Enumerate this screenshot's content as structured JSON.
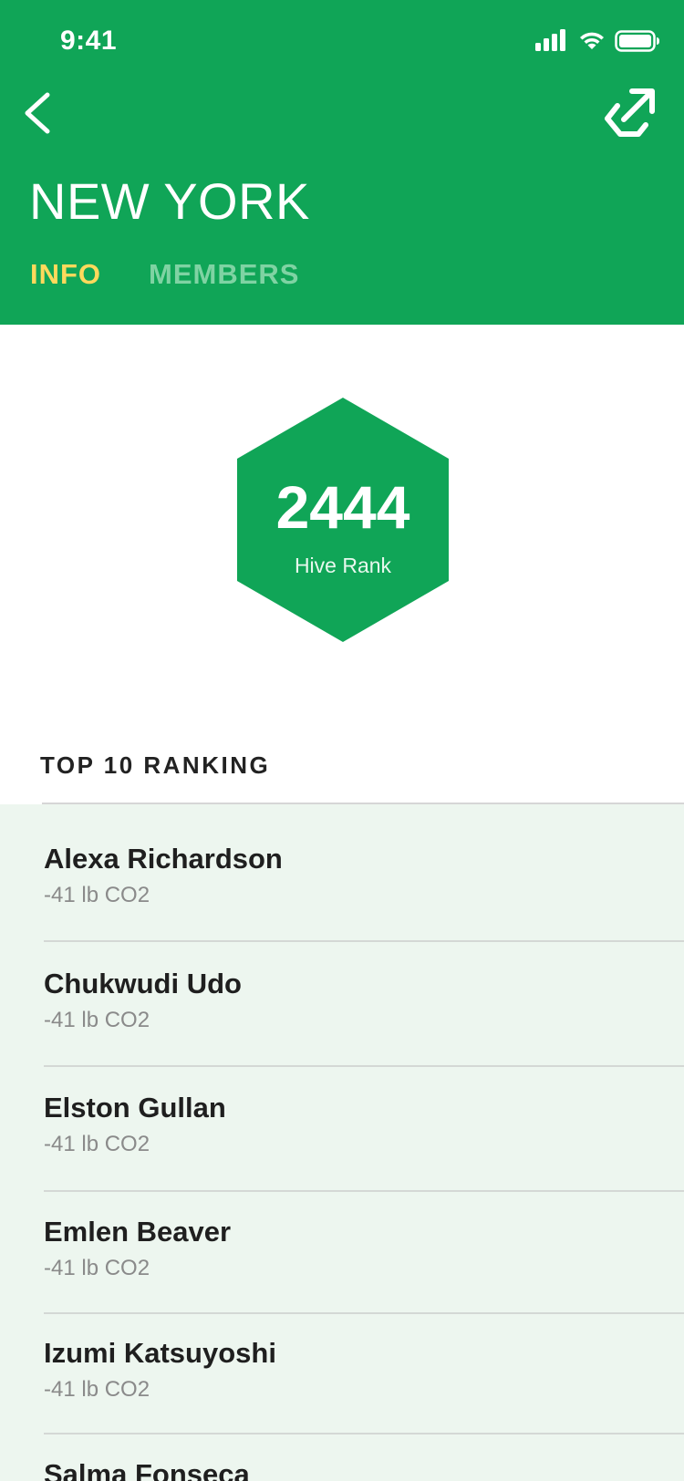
{
  "status_bar": {
    "time": "9:41"
  },
  "header": {
    "back_icon": "chevron-left-icon",
    "share_icon": "external-link-icon",
    "title": "NEW YORK",
    "tabs": [
      {
        "label": "INFO",
        "active": true
      },
      {
        "label": "MEMBERS",
        "active": false
      }
    ]
  },
  "rank": {
    "value": "2444",
    "label": "Hive Rank"
  },
  "ranking": {
    "title": "TOP 10 RANKING",
    "items": [
      {
        "name": "Alexa Richardson",
        "co2": "-41 lb CO2"
      },
      {
        "name": "Chukwudi Udo",
        "co2": "-41 lb CO2"
      },
      {
        "name": "Elston Gullan",
        "co2": "-41 lb CO2"
      },
      {
        "name": "Emlen Beaver",
        "co2": "-41 lb CO2"
      },
      {
        "name": "Izumi Katsuyoshi",
        "co2": "-41 lb CO2"
      },
      {
        "name": "Salma Fonseca",
        "co2": ""
      }
    ]
  },
  "colors": {
    "brand_green": "#10a557",
    "active_tab": "#ffd95c",
    "inactive_tab": "#7fd3a3",
    "list_background": "#edf6ef"
  }
}
